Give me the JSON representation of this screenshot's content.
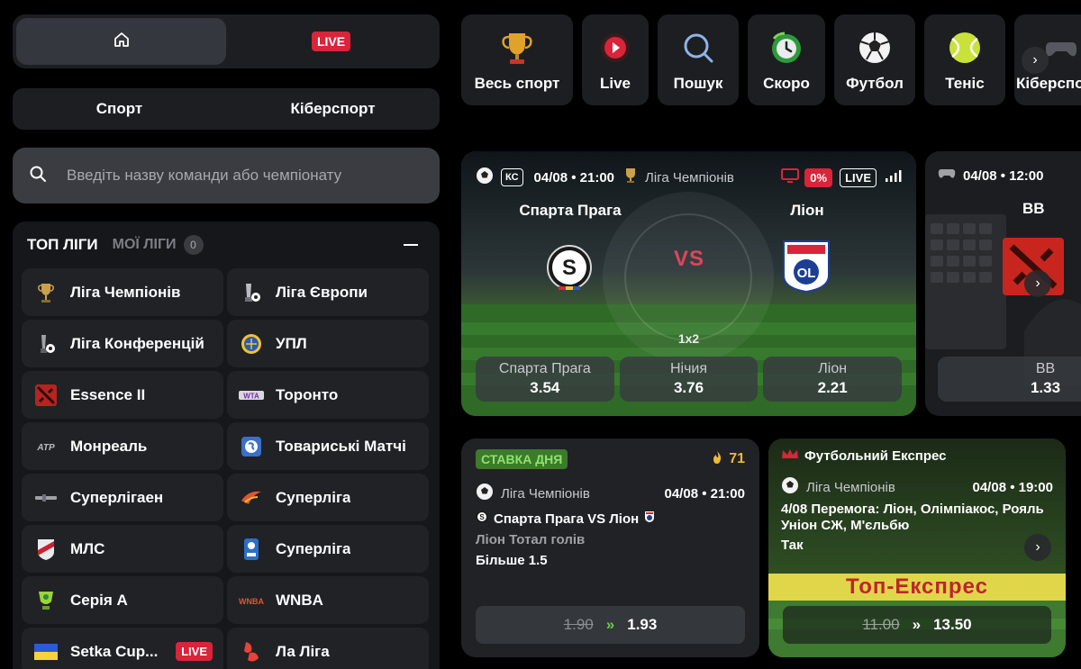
{
  "nav": {
    "home_icon": "home-icon",
    "live_label": "LIVE",
    "tabs": [
      "Спорт",
      "Кіберспорт"
    ]
  },
  "search": {
    "placeholder": "Введіть назву команди або чемпіонату"
  },
  "leagues_panel": {
    "top_label": "ТОП ЛІГИ",
    "my_label": "МОЇ ЛІГИ",
    "my_count": "0",
    "items": [
      {
        "label": "Ліга Чемпіонів",
        "icon": "ucl-trophy-icon"
      },
      {
        "label": "Ліга Європи",
        "icon": "uel-trophy-icon"
      },
      {
        "label": "Ліга Конференцій",
        "icon": "uecl-trophy-icon"
      },
      {
        "label": "УПЛ",
        "icon": "upl-logo-icon"
      },
      {
        "label": "Essence II",
        "icon": "dota-icon"
      },
      {
        "label": "Торонто",
        "icon": "wta-icon"
      },
      {
        "label": "Монреаль",
        "icon": "atp-icon"
      },
      {
        "label": "Товариські Матчі",
        "icon": "globe-icon"
      },
      {
        "label": "Суперлігаен",
        "icon": "superliga-dk-icon"
      },
      {
        "label": "Суперліга",
        "icon": "superliga-icon"
      },
      {
        "label": "МЛС",
        "icon": "mls-icon"
      },
      {
        "label": "Суперліга",
        "icon": "vbet-superliga-icon"
      },
      {
        "label": "Серія А",
        "icon": "serie-a-brazil-icon"
      },
      {
        "label": "WNBA",
        "icon": "wnba-icon"
      },
      {
        "label": "Setka Cup...",
        "icon": "ukraine-flag-icon",
        "live": "LIVE"
      },
      {
        "label": "Ла Ліга",
        "icon": "laliga-icon"
      }
    ]
  },
  "sports_strip": [
    {
      "label": "Весь спорт",
      "icon": "trophy-icon"
    },
    {
      "label": "Live",
      "icon": "live-play-icon"
    },
    {
      "label": "Пошук",
      "icon": "search-icon"
    },
    {
      "label": "Скоро",
      "icon": "clock-icon"
    },
    {
      "label": "Футбол",
      "icon": "soccer-ball-icon"
    },
    {
      "label": "Теніс",
      "icon": "tennis-ball-icon"
    },
    {
      "label": "Кіберспорт",
      "icon": "gamepad-icon"
    }
  ],
  "match": {
    "sport_icon": "soccer-ball-icon",
    "ks_badge": "КС",
    "datetime": "04/08 • 21:00",
    "league": "Ліга Чемпіонів",
    "percent": "0%",
    "live": "LIVE",
    "home": "Спарта Прага",
    "away": "Ліон",
    "vs": "VS",
    "market": "1x2",
    "odds": [
      {
        "name": "Спарта Прага",
        "value": "3.54"
      },
      {
        "name": "Нічия",
        "value": "3.76"
      },
      {
        "name": "Ліон",
        "value": "2.21"
      }
    ]
  },
  "match2": {
    "datetime": "04/08 • 12:00",
    "team": "BB",
    "odds_name": "BB",
    "odds_value": "1.33"
  },
  "bet_of_day": {
    "badge": "СТАВКА ДНЯ",
    "count": "71",
    "league": "Ліга Чемпіонів",
    "datetime": "04/08 • 21:00",
    "teams": "Спарта Прага VS Ліон",
    "market": "Ліон Тотал голів",
    "pick": "Більше 1.5",
    "old_odds": "1.90",
    "new_odds": "1.93"
  },
  "express": {
    "title": "Футбольний Експрес",
    "league": "Ліга Чемпіонів",
    "datetime": "04/08 • 19:00",
    "description": "4/08 Перемога: Ліон, Олімпіакос, Рояль Уніон СЖ, М'єльбю",
    "answer": "Так",
    "banner": "Топ-Експрес",
    "old_odds": "11.00",
    "new_odds": "13.50"
  },
  "colors": {
    "accent_red": "#d9243a",
    "bet_badge_green": "#8fe36b",
    "odds_arrow_green": "#6bcf4a"
  }
}
